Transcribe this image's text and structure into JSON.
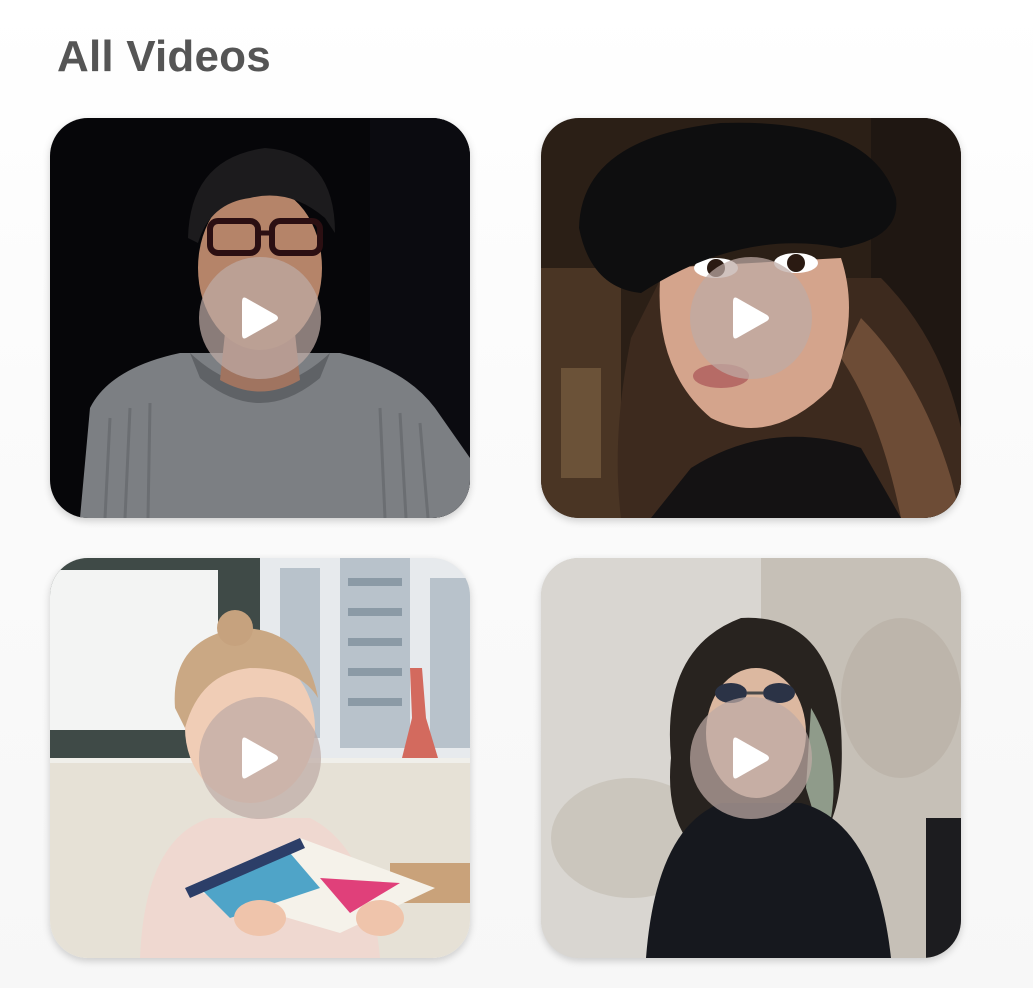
{
  "page": {
    "title": "All Videos"
  },
  "videos": [
    {
      "thumbnail": "man-glasses-gray-hoodie",
      "icon": "play-icon"
    },
    {
      "thumbnail": "woman-black-beret",
      "icon": "play-icon"
    },
    {
      "thumbnail": "girl-reading-book",
      "icon": "play-icon"
    },
    {
      "thumbnail": "woman-sunglasses-black-sweater",
      "icon": "play-icon"
    }
  ],
  "colors": {
    "title": "#555555",
    "play_overlay": "#bea9a5",
    "play_glyph": "#ffffff",
    "background": "#f9f9f9"
  }
}
